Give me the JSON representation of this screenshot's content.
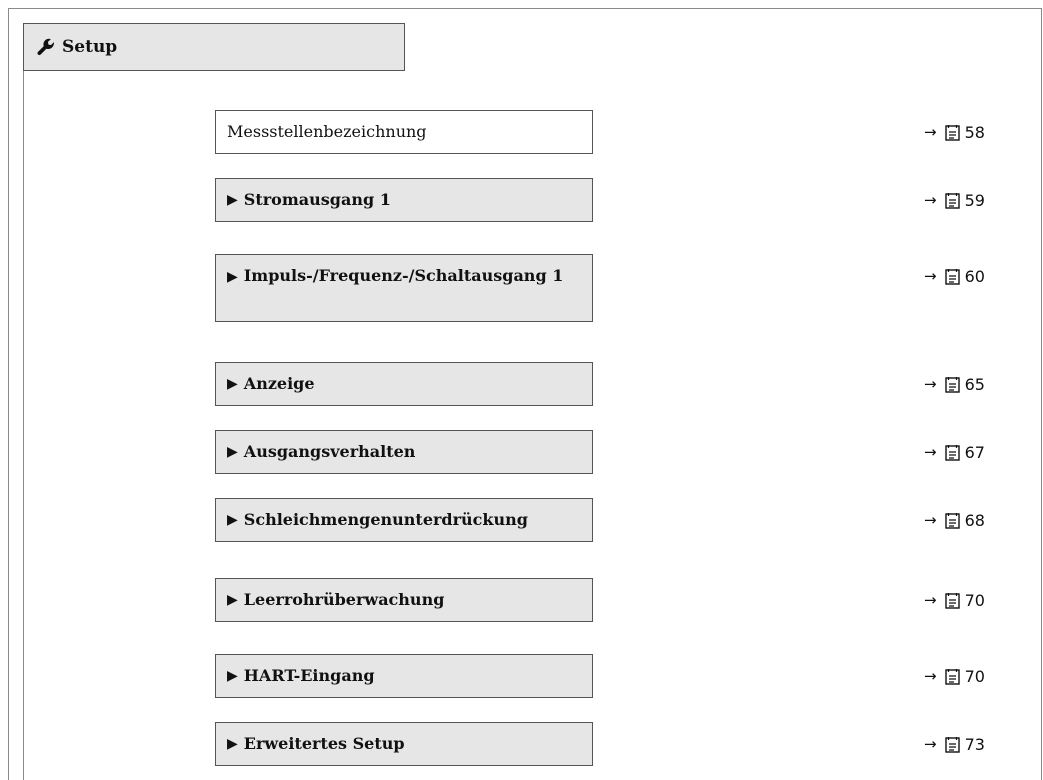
{
  "header": {
    "title": "Setup",
    "icon": "wrench-icon"
  },
  "items": [
    {
      "label": "Messstellenbezeichnung",
      "kind": "parameter",
      "page": "58"
    },
    {
      "label": "Stromausgang 1",
      "kind": "submenu",
      "page": "59"
    },
    {
      "label": "Impuls-/Frequenz-/Schaltausgang 1",
      "kind": "submenu",
      "page": "60"
    },
    {
      "label": "Anzeige",
      "kind": "submenu",
      "page": "65"
    },
    {
      "label": "Ausgangsverhalten",
      "kind": "submenu",
      "page": "67"
    },
    {
      "label": "Schleichmengenunterdrückung",
      "kind": "submenu",
      "page": "68"
    },
    {
      "label": "Leerrohrüberwachung",
      "kind": "submenu",
      "page": "70"
    },
    {
      "label": "HART-Eingang",
      "kind": "submenu",
      "page": "70"
    },
    {
      "label": "Erweitertes Setup",
      "kind": "submenu",
      "page": "73"
    }
  ],
  "glyphs": {
    "submenu_marker": "▶",
    "ref_arrow": "→",
    "page_icon": "book-icon"
  }
}
